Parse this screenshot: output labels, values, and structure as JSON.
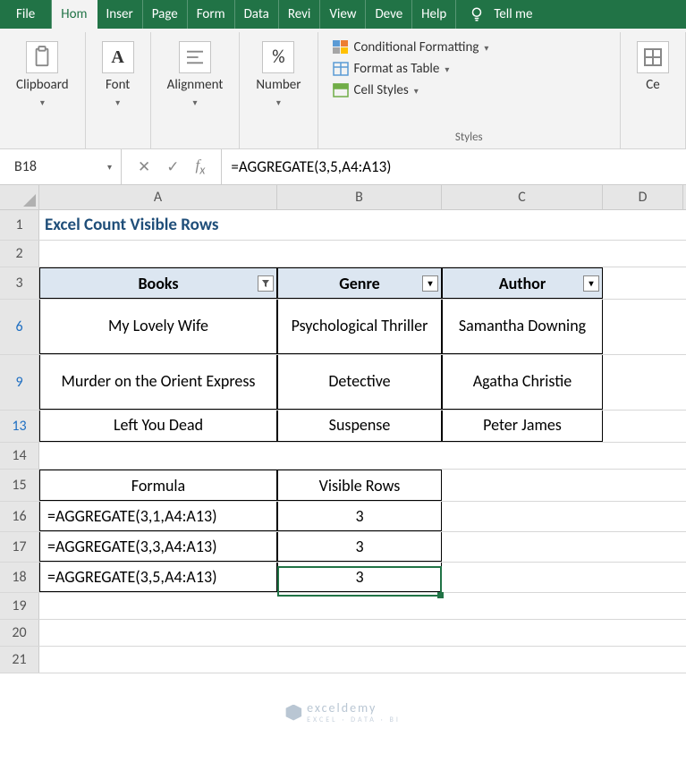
{
  "tabs": {
    "file": "File",
    "home": "Hom",
    "insert": "Inser",
    "page": "Page",
    "form": "Form",
    "data": "Data",
    "review": "Revi",
    "view": "View",
    "dev": "Deve",
    "help": "Help",
    "tellme": "Tell me"
  },
  "ribbon": {
    "clipboard": "Clipboard",
    "font": "Font",
    "alignment": "Alignment",
    "number": "Number",
    "styles": "Styles",
    "cond_fmt": "Conditional Formatting",
    "fmt_table": "Format as Table",
    "cell_styles": "Cell Styles",
    "cells": "Ce",
    "font_glyph": "A",
    "number_glyph": "%"
  },
  "formula_bar": {
    "namebox": "B18",
    "formula": "=AGGREGATE(3,5,A4:A13)"
  },
  "columns": {
    "A": "A",
    "B": "B",
    "C": "C",
    "D": "D"
  },
  "rows": {
    "r1": "1",
    "r2": "2",
    "r3": "3",
    "r6": "6",
    "r9": "9",
    "r13": "13",
    "r14": "14",
    "r15": "15",
    "r16": "16",
    "r17": "17",
    "r18": "18",
    "r19": "19",
    "r20": "20",
    "r21": "21"
  },
  "sheet": {
    "title": "Excel Count Visible Rows",
    "headers": {
      "books": "Books",
      "genre": "Genre",
      "author": "Author"
    },
    "data": [
      {
        "book": "My Lovely Wife",
        "genre": "Psychological Thriller",
        "author": "Samantha Downing"
      },
      {
        "book": "Murder on the Orient Express",
        "genre": "Detective",
        "author": "Agatha Christie"
      },
      {
        "book": "Left You Dead",
        "genre": "Suspense",
        "author": "Peter James"
      }
    ],
    "formula_section": {
      "h1": "Formula",
      "h2": "Visible Rows",
      "rows": [
        {
          "f": "=AGGREGATE(3,1,A4:A13)",
          "v": "3"
        },
        {
          "f": "=AGGREGATE(3,3,A4:A13)",
          "v": "3"
        },
        {
          "f": "=AGGREGATE(3,5,A4:A13)",
          "v": "3"
        }
      ]
    }
  },
  "watermark": {
    "name": "exceldemy",
    "sub": "EXCEL · DATA · BI"
  }
}
